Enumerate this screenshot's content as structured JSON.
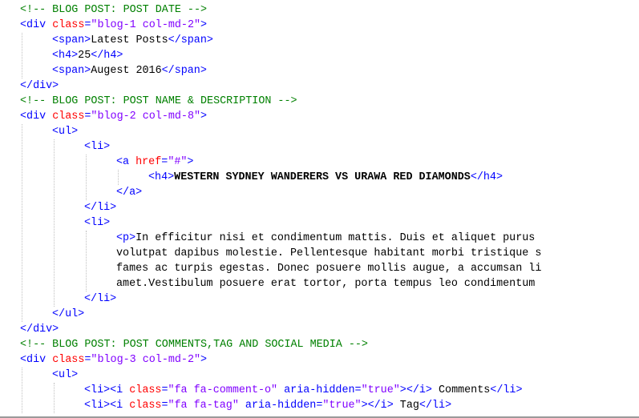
{
  "editor": {
    "lines": [
      {
        "indent": 0,
        "tokens": [
          {
            "t": "comment",
            "v": "<!-- BLOG POST: POST DATE -->"
          }
        ]
      },
      {
        "indent": 0,
        "tokens": [
          {
            "t": "tag",
            "v": "<div "
          },
          {
            "t": "attr",
            "v": "class"
          },
          {
            "t": "tag",
            "v": "="
          },
          {
            "t": "value",
            "v": "\"blog-1 col-md-2\""
          },
          {
            "t": "tag",
            "v": ">"
          }
        ]
      },
      {
        "indent": 1,
        "tokens": [
          {
            "t": "tag",
            "v": "<span>"
          },
          {
            "t": "text",
            "v": "Latest Posts"
          },
          {
            "t": "tag",
            "v": "</span>"
          }
        ]
      },
      {
        "indent": 1,
        "tokens": [
          {
            "t": "tag",
            "v": "<h4>"
          },
          {
            "t": "text",
            "v": "25"
          },
          {
            "t": "tag",
            "v": "</h4>"
          }
        ]
      },
      {
        "indent": 1,
        "tokens": [
          {
            "t": "tag",
            "v": "<span>"
          },
          {
            "t": "text",
            "v": "Augest 2016"
          },
          {
            "t": "tag",
            "v": "</span>"
          }
        ]
      },
      {
        "indent": 0,
        "tokens": [
          {
            "t": "tag",
            "v": "</div>"
          }
        ]
      },
      {
        "indent": 0,
        "tokens": [
          {
            "t": "comment",
            "v": "<!-- BLOG POST: POST NAME & DESCRIPTION -->"
          }
        ]
      },
      {
        "indent": 0,
        "tokens": [
          {
            "t": "tag",
            "v": "<div "
          },
          {
            "t": "attr",
            "v": "class"
          },
          {
            "t": "tag",
            "v": "="
          },
          {
            "t": "value",
            "v": "\"blog-2 col-md-8\""
          },
          {
            "t": "tag",
            "v": ">"
          }
        ]
      },
      {
        "indent": 1,
        "tokens": [
          {
            "t": "tag",
            "v": "<ul>"
          }
        ]
      },
      {
        "indent": 2,
        "tokens": [
          {
            "t": "tag",
            "v": "<li>"
          }
        ]
      },
      {
        "indent": 3,
        "tokens": [
          {
            "t": "tag",
            "v": "<a "
          },
          {
            "t": "attr",
            "v": "href"
          },
          {
            "t": "tag",
            "v": "="
          },
          {
            "t": "value",
            "v": "\"#\""
          },
          {
            "t": "tag",
            "v": ">"
          }
        ]
      },
      {
        "indent": 4,
        "tokens": [
          {
            "t": "tag",
            "v": "<h4>"
          },
          {
            "t": "bold",
            "v": "WESTERN SYDNEY WANDERERS VS URAWA RED DIAMONDS"
          },
          {
            "t": "tag",
            "v": "</h4>"
          }
        ]
      },
      {
        "indent": 3,
        "tokens": [
          {
            "t": "tag",
            "v": "</a>"
          }
        ]
      },
      {
        "indent": 2,
        "tokens": [
          {
            "t": "tag",
            "v": "</li>"
          }
        ]
      },
      {
        "indent": 2,
        "tokens": [
          {
            "t": "tag",
            "v": "<li>"
          }
        ]
      },
      {
        "indent": 3,
        "tokens": [
          {
            "t": "tag",
            "v": "<p>"
          },
          {
            "t": "text",
            "v": "In efficitur nisi et condimentum mattis. Duis et aliquet purus"
          }
        ]
      },
      {
        "indent": 3,
        "tokens": [
          {
            "t": "text",
            "v": "volutpat dapibus molestie. Pellentesque habitant morbi tristique s"
          }
        ]
      },
      {
        "indent": 3,
        "tokens": [
          {
            "t": "text",
            "v": "fames ac turpis egestas. Donec posuere mollis augue, a accumsan li"
          }
        ]
      },
      {
        "indent": 3,
        "tokens": [
          {
            "t": "text",
            "v": "amet.Vestibulum posuere erat tortor, porta tempus leo condimentum"
          }
        ]
      },
      {
        "indent": 2,
        "tokens": [
          {
            "t": "tag",
            "v": "</li>"
          }
        ]
      },
      {
        "indent": 1,
        "tokens": [
          {
            "t": "tag",
            "v": "</ul>"
          }
        ]
      },
      {
        "indent": 0,
        "tokens": [
          {
            "t": "tag",
            "v": "</div>"
          }
        ]
      },
      {
        "indent": 0,
        "tokens": [
          {
            "t": "comment",
            "v": "<!-- BLOG POST: POST COMMENTS,TAG AND SOCIAL MEDIA -->"
          }
        ]
      },
      {
        "indent": 0,
        "tokens": [
          {
            "t": "tag",
            "v": "<div "
          },
          {
            "t": "attr",
            "v": "class"
          },
          {
            "t": "tag",
            "v": "="
          },
          {
            "t": "value",
            "v": "\"blog-3 col-md-2\""
          },
          {
            "t": "tag",
            "v": ">"
          }
        ]
      },
      {
        "indent": 1,
        "tokens": [
          {
            "t": "tag",
            "v": "<ul>"
          }
        ]
      },
      {
        "indent": 2,
        "tokens": [
          {
            "t": "tag",
            "v": "<li><i "
          },
          {
            "t": "attr",
            "v": "class"
          },
          {
            "t": "tag",
            "v": "="
          },
          {
            "t": "value",
            "v": "\"fa fa-comment-o\""
          },
          {
            "t": "tag",
            "v": " aria-hidden="
          },
          {
            "t": "value",
            "v": "\"true\""
          },
          {
            "t": "tag",
            "v": "></i>"
          },
          {
            "t": "text",
            "v": " Comments"
          },
          {
            "t": "tag",
            "v": "</li>"
          }
        ]
      },
      {
        "indent": 2,
        "tokens": [
          {
            "t": "tag",
            "v": "<li><i "
          },
          {
            "t": "attr",
            "v": "class"
          },
          {
            "t": "tag",
            "v": "="
          },
          {
            "t": "value",
            "v": "\"fa fa-tag\""
          },
          {
            "t": "tag",
            "v": " aria-hidden="
          },
          {
            "t": "value",
            "v": "\"true\""
          },
          {
            "t": "tag",
            "v": "></i>"
          },
          {
            "t": "text",
            "v": " Tag"
          },
          {
            "t": "tag",
            "v": "</li>"
          }
        ]
      }
    ]
  }
}
